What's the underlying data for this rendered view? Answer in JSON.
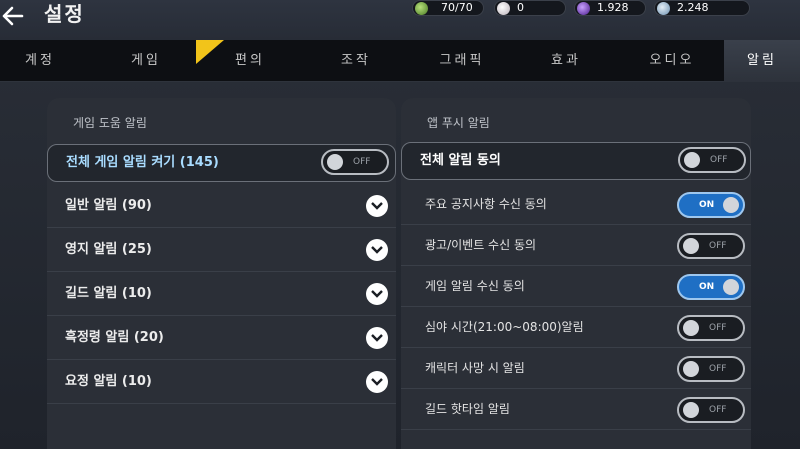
{
  "header": {
    "title": "설정",
    "resources": {
      "stamina": "70/70",
      "pearl": "0",
      "crystal": "1.928",
      "silver": "2.248"
    }
  },
  "tabs": [
    {
      "label": "계정"
    },
    {
      "label": "게임"
    },
    {
      "label": "편의"
    },
    {
      "label": "조작"
    },
    {
      "label": "그래픽"
    },
    {
      "label": "효과"
    },
    {
      "label": "오디오"
    },
    {
      "label": "알림"
    }
  ],
  "active_tab": "알림",
  "left_panel": {
    "header": "게임 도움 알림",
    "master": {
      "label": "전체 게임 알림 켜기 (145)",
      "toggle": "OFF"
    },
    "items": [
      {
        "label": "일반 알림 (90)"
      },
      {
        "label": "영지 알림 (25)"
      },
      {
        "label": "길드 알림 (10)"
      },
      {
        "label": "흑정령 알림 (20)"
      },
      {
        "label": "요정 알림 (10)"
      }
    ]
  },
  "right_panel": {
    "header": "앱 푸시 알림",
    "master": {
      "label": "전체 알림 동의",
      "toggle": "OFF"
    },
    "items": [
      {
        "label": "주요 공지사항 수신 동의",
        "toggle": "ON"
      },
      {
        "label": "광고/이벤트 수신 동의",
        "toggle": "OFF"
      },
      {
        "label": "게임 알림 수신 동의",
        "toggle": "ON"
      },
      {
        "label": "심야 시간(21:00~08:00)알림",
        "toggle": "OFF"
      },
      {
        "label": "캐릭터 사망 시 알림",
        "toggle": "OFF"
      },
      {
        "label": "길드 핫타임 알림",
        "toggle": "OFF"
      }
    ]
  },
  "colors": {
    "toggle_on": "#1f6fc4",
    "master_label": "#a9dcff",
    "badge": "#f2c41a"
  }
}
